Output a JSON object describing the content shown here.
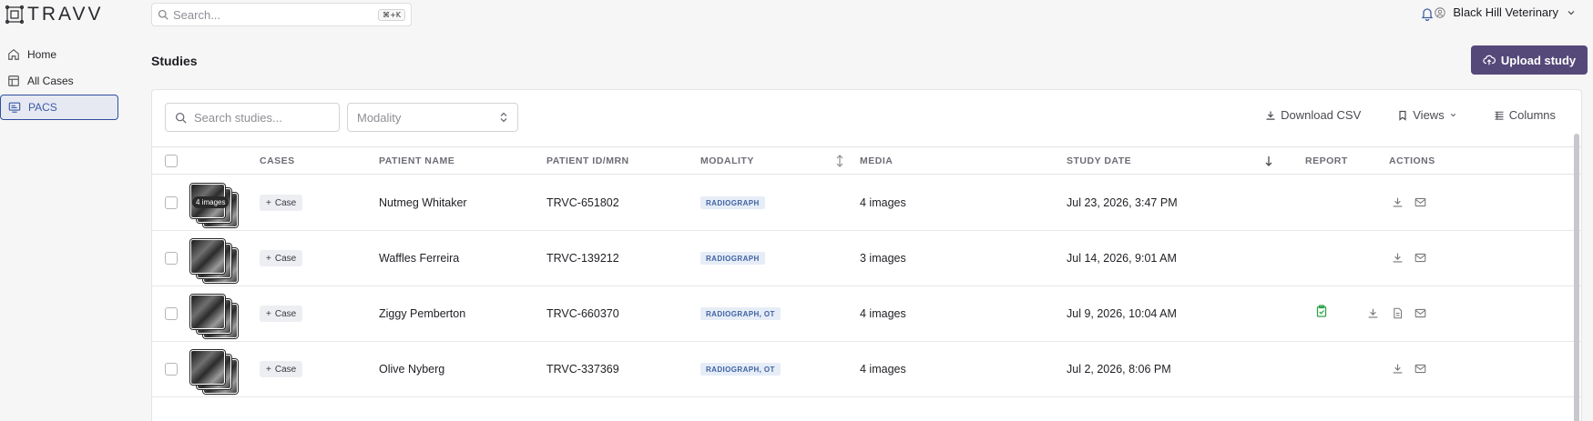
{
  "app": {
    "name": "TRAVV"
  },
  "topbar": {
    "search_placeholder": "Search...",
    "shortcut": "⌘+K",
    "account": "Black Hill Veterinary"
  },
  "sidebar": {
    "items": [
      {
        "label": "Home",
        "icon": "home-icon"
      },
      {
        "label": "All Cases",
        "icon": "table-icon"
      },
      {
        "label": "PACS",
        "icon": "monitor-icon",
        "active": true
      }
    ]
  },
  "page": {
    "title": "Studies",
    "upload_label": "Upload study"
  },
  "filters": {
    "search_placeholder": "Search studies...",
    "modality_placeholder": "Modality"
  },
  "toolbar": {
    "download": "Download CSV",
    "views": "Views",
    "columns": "Columns"
  },
  "columns": {
    "cases": "CASES",
    "patient_name": "PATIENT NAME",
    "patient_id": "PATIENT ID/MRN",
    "modality": "MODALITY",
    "media": "MEDIA",
    "study_date": "STUDY DATE",
    "report": "REPORT",
    "actions": "ACTIONS"
  },
  "case_label": "Case",
  "rows": [
    {
      "badge": "4 images",
      "name": "Nutmeg Whitaker",
      "id": "TRVC-651802",
      "modality": "RADIOGRAPH",
      "media": "4 images",
      "date": "Jul 23, 2026, 3:47 PM",
      "has_report": false
    },
    {
      "badge": "",
      "name": "Waffles Ferreira",
      "id": "TRVC-139212",
      "modality": "RADIOGRAPH",
      "media": "3 images",
      "date": "Jul 14, 2026, 9:01 AM",
      "has_report": false
    },
    {
      "badge": "",
      "name": "Ziggy Pemberton",
      "id": "TRVC-660370",
      "modality": "RADIOGRAPH, OT",
      "media": "4 images",
      "date": "Jul 9, 2026, 10:04 AM",
      "has_report": true
    },
    {
      "badge": "",
      "name": "Olive Nyberg",
      "id": "TRVC-337369",
      "modality": "RADIOGRAPH, OT",
      "media": "4 images",
      "date": "Jul 2, 2026, 8:06 PM",
      "has_report": false
    }
  ],
  "colors": {
    "primary": "#55497a",
    "badge_bg": "#e6edf7",
    "badge_text": "#3f62a3",
    "report_green": "#2fa24a",
    "active_nav": "#2f4ea0"
  }
}
